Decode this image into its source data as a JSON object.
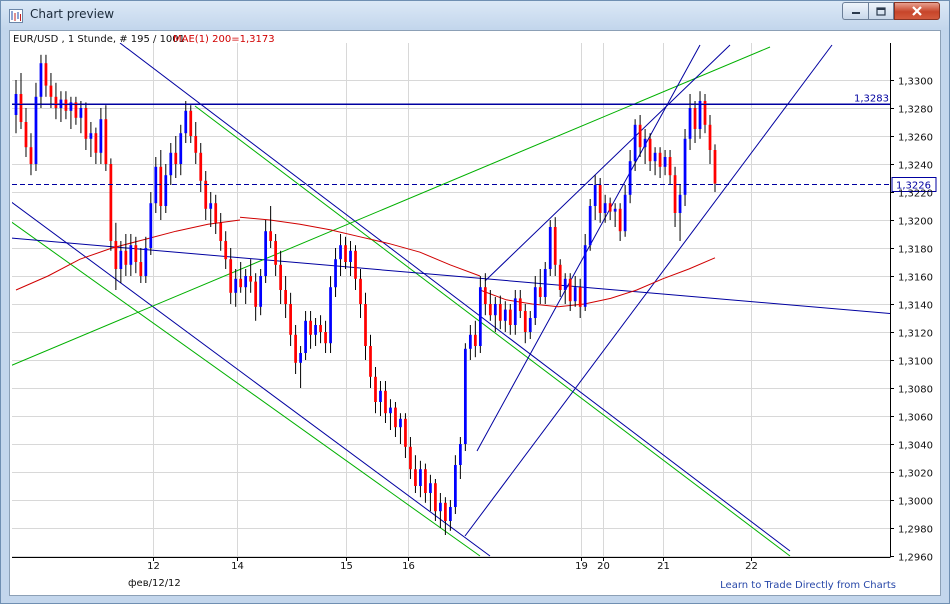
{
  "window": {
    "title": "Chart preview",
    "buttons": {
      "minimize": "minimize-icon",
      "maximize": "maximize-icon",
      "close": "close-icon"
    }
  },
  "chart_data": {
    "type": "candlestick",
    "header": "EUR/USD , 1 Stunde, # 195 / 1001",
    "indicator_label": "MAE(1) 200=1,3173",
    "ylim": [
      1.2955,
      1.3342
    ],
    "y_ticks": [
      "1,3300",
      "1,3280",
      "1,3260",
      "1,3240",
      "1,3220",
      "1,3200",
      "1,3180",
      "1,3160",
      "1,3140",
      "1,3120",
      "1,3100",
      "1,3080",
      "1,3060",
      "1,3040",
      "1,3020",
      "1,3000",
      "1,2980",
      "1,2960"
    ],
    "x_ticks": [
      "12",
      "14",
      "15",
      "16",
      "19",
      "20",
      "21",
      "22"
    ],
    "date_label": "фев/12/12",
    "level_line": {
      "value": 1.3283,
      "label": "1,3283"
    },
    "price_line": {
      "value": 1.3226,
      "label": "1,3226"
    },
    "footer_link": "Learn to Trade Directly from Charts",
    "colors": {
      "bull": "#0000ff",
      "bear": "#ff0000",
      "trend_blue": "#0000a0",
      "trend_green": "#00c000",
      "ma": "#d00000",
      "grid": "#d8d8d8"
    },
    "moving_average": [
      [
        1.315,
        1.316,
        1.3172,
        1.318,
        1.3186,
        1.3192,
        1.3197,
        1.32
      ],
      [
        1.3202,
        1.32,
        1.3197,
        1.3193,
        1.3188,
        1.3183,
        1.3177,
        1.3168,
        1.316
      ],
      [
        1.315,
        1.3143,
        1.314,
        1.3138,
        1.314,
        1.3144,
        1.315,
        1.3158,
        1.3165,
        1.3173
      ]
    ],
    "candles": [
      {
        "o": 1.3275,
        "h": 1.33,
        "l": 1.3262,
        "c": 1.329
      },
      {
        "o": 1.329,
        "h": 1.3305,
        "l": 1.3265,
        "c": 1.327
      },
      {
        "o": 1.327,
        "h": 1.328,
        "l": 1.3245,
        "c": 1.3252
      },
      {
        "o": 1.3252,
        "h": 1.3262,
        "l": 1.3232,
        "c": 1.324
      },
      {
        "o": 1.324,
        "h": 1.3298,
        "l": 1.3235,
        "c": 1.3288
      },
      {
        "o": 1.3288,
        "h": 1.3318,
        "l": 1.328,
        "c": 1.3312
      },
      {
        "o": 1.3312,
        "h": 1.3318,
        "l": 1.3288,
        "c": 1.3296
      },
      {
        "o": 1.3296,
        "h": 1.3305,
        "l": 1.328,
        "c": 1.3288
      },
      {
        "o": 1.3288,
        "h": 1.3298,
        "l": 1.3272,
        "c": 1.328
      },
      {
        "o": 1.328,
        "h": 1.3292,
        "l": 1.327,
        "c": 1.3286
      },
      {
        "o": 1.3286,
        "h": 1.3292,
        "l": 1.3272,
        "c": 1.3278
      },
      {
        "o": 1.3278,
        "h": 1.3288,
        "l": 1.3265,
        "c": 1.3284
      },
      {
        "o": 1.3284,
        "h": 1.3288,
        "l": 1.3268,
        "c": 1.3273
      },
      {
        "o": 1.3273,
        "h": 1.3285,
        "l": 1.3262,
        "c": 1.328
      },
      {
        "o": 1.328,
        "h": 1.3284,
        "l": 1.325,
        "c": 1.3258
      },
      {
        "o": 1.3258,
        "h": 1.327,
        "l": 1.3245,
        "c": 1.3262
      },
      {
        "o": 1.3262,
        "h": 1.3266,
        "l": 1.324,
        "c": 1.3248
      },
      {
        "o": 1.3248,
        "h": 1.328,
        "l": 1.324,
        "c": 1.3272
      },
      {
        "o": 1.3272,
        "h": 1.3282,
        "l": 1.3235,
        "c": 1.324
      },
      {
        "o": 1.324,
        "h": 1.3244,
        "l": 1.3178,
        "c": 1.3185
      },
      {
        "o": 1.3185,
        "h": 1.3198,
        "l": 1.315,
        "c": 1.3165
      },
      {
        "o": 1.3165,
        "h": 1.3185,
        "l": 1.3155,
        "c": 1.3178
      },
      {
        "o": 1.3178,
        "h": 1.319,
        "l": 1.316,
        "c": 1.3168
      },
      {
        "o": 1.3168,
        "h": 1.319,
        "l": 1.316,
        "c": 1.3182
      },
      {
        "o": 1.3182,
        "h": 1.3188,
        "l": 1.3162,
        "c": 1.317
      },
      {
        "o": 1.317,
        "h": 1.318,
        "l": 1.3155,
        "c": 1.316
      },
      {
        "o": 1.316,
        "h": 1.3188,
        "l": 1.3155,
        "c": 1.318
      },
      {
        "o": 1.318,
        "h": 1.322,
        "l": 1.3175,
        "c": 1.3212
      },
      {
        "o": 1.3212,
        "h": 1.3245,
        "l": 1.3205,
        "c": 1.3238
      },
      {
        "o": 1.3238,
        "h": 1.325,
        "l": 1.32,
        "c": 1.321
      },
      {
        "o": 1.321,
        "h": 1.324,
        "l": 1.3205,
        "c": 1.3232
      },
      {
        "o": 1.3232,
        "h": 1.3255,
        "l": 1.3225,
        "c": 1.3248
      },
      {
        "o": 1.3248,
        "h": 1.326,
        "l": 1.323,
        "c": 1.324
      },
      {
        "o": 1.324,
        "h": 1.3268,
        "l": 1.3232,
        "c": 1.3262
      },
      {
        "o": 1.3262,
        "h": 1.3285,
        "l": 1.3255,
        "c": 1.3278
      },
      {
        "o": 1.3278,
        "h": 1.3282,
        "l": 1.3255,
        "c": 1.326
      },
      {
        "o": 1.326,
        "h": 1.327,
        "l": 1.324,
        "c": 1.3248
      },
      {
        "o": 1.3248,
        "h": 1.3255,
        "l": 1.322,
        "c": 1.3228
      },
      {
        "o": 1.3228,
        "h": 1.3235,
        "l": 1.32,
        "c": 1.3208
      },
      {
        "o": 1.3208,
        "h": 1.322,
        "l": 1.3195,
        "c": 1.3212
      },
      {
        "o": 1.3212,
        "h": 1.3218,
        "l": 1.319,
        "c": 1.3198
      },
      {
        "o": 1.3198,
        "h": 1.3205,
        "l": 1.3178,
        "c": 1.3185
      },
      {
        "o": 1.3185,
        "h": 1.3192,
        "l": 1.3165,
        "c": 1.3172
      },
      {
        "o": 1.3172,
        "h": 1.318,
        "l": 1.314,
        "c": 1.3148
      },
      {
        "o": 1.3148,
        "h": 1.3165,
        "l": 1.3138,
        "c": 1.3158
      },
      {
        "o": 1.3158,
        "h": 1.317,
        "l": 1.3148,
        "c": 1.3152
      },
      {
        "o": 1.3152,
        "h": 1.3165,
        "l": 1.314,
        "c": 1.316
      },
      {
        "o": 1.316,
        "h": 1.3172,
        "l": 1.3148,
        "c": 1.3156
      },
      {
        "o": 1.3156,
        "h": 1.3162,
        "l": 1.3128,
        "c": 1.3138
      },
      {
        "o": 1.3138,
        "h": 1.3165,
        "l": 1.3132,
        "c": 1.316
      },
      {
        "o": 1.316,
        "h": 1.32,
        "l": 1.3155,
        "c": 1.3192
      },
      {
        "o": 1.3192,
        "h": 1.321,
        "l": 1.318,
        "c": 1.3185
      },
      {
        "o": 1.3185,
        "h": 1.319,
        "l": 1.316,
        "c": 1.3168
      },
      {
        "o": 1.3168,
        "h": 1.3178,
        "l": 1.314,
        "c": 1.315
      },
      {
        "o": 1.315,
        "h": 1.316,
        "l": 1.313,
        "c": 1.314
      },
      {
        "o": 1.314,
        "h": 1.3148,
        "l": 1.311,
        "c": 1.3118
      },
      {
        "o": 1.3118,
        "h": 1.3125,
        "l": 1.309,
        "c": 1.3098
      },
      {
        "o": 1.3098,
        "h": 1.311,
        "l": 1.308,
        "c": 1.3105
      },
      {
        "o": 1.3105,
        "h": 1.3135,
        "l": 1.31,
        "c": 1.3128
      },
      {
        "o": 1.3128,
        "h": 1.3135,
        "l": 1.3108,
        "c": 1.3118
      },
      {
        "o": 1.3118,
        "h": 1.313,
        "l": 1.311,
        "c": 1.3125
      },
      {
        "o": 1.3125,
        "h": 1.3132,
        "l": 1.3112,
        "c": 1.312
      },
      {
        "o": 1.312,
        "h": 1.3128,
        "l": 1.3105,
        "c": 1.3112
      },
      {
        "o": 1.3112,
        "h": 1.316,
        "l": 1.3105,
        "c": 1.3152
      },
      {
        "o": 1.3152,
        "h": 1.318,
        "l": 1.3145,
        "c": 1.3172
      },
      {
        "o": 1.3172,
        "h": 1.319,
        "l": 1.316,
        "c": 1.3182
      },
      {
        "o": 1.3182,
        "h": 1.3188,
        "l": 1.3165,
        "c": 1.317
      },
      {
        "o": 1.317,
        "h": 1.3185,
        "l": 1.316,
        "c": 1.3178
      },
      {
        "o": 1.3178,
        "h": 1.3182,
        "l": 1.315,
        "c": 1.3158
      },
      {
        "o": 1.3158,
        "h": 1.3165,
        "l": 1.313,
        "c": 1.314
      },
      {
        "o": 1.314,
        "h": 1.3148,
        "l": 1.31,
        "c": 1.311
      },
      {
        "o": 1.311,
        "h": 1.3118,
        "l": 1.308,
        "c": 1.3088
      },
      {
        "o": 1.3088,
        "h": 1.3095,
        "l": 1.3062,
        "c": 1.307
      },
      {
        "o": 1.307,
        "h": 1.3085,
        "l": 1.306,
        "c": 1.3078
      },
      {
        "o": 1.3078,
        "h": 1.3085,
        "l": 1.3055,
        "c": 1.3062
      },
      {
        "o": 1.3062,
        "h": 1.3072,
        "l": 1.305,
        "c": 1.3066
      },
      {
        "o": 1.3066,
        "h": 1.307,
        "l": 1.3045,
        "c": 1.3052
      },
      {
        "o": 1.3052,
        "h": 1.3062,
        "l": 1.304,
        "c": 1.3058
      },
      {
        "o": 1.3058,
        "h": 1.3062,
        "l": 1.303,
        "c": 1.3038
      },
      {
        "o": 1.3038,
        "h": 1.3045,
        "l": 1.3015,
        "c": 1.3022
      },
      {
        "o": 1.3022,
        "h": 1.3032,
        "l": 1.3005,
        "c": 1.301
      },
      {
        "o": 1.301,
        "h": 1.3028,
        "l": 1.3002,
        "c": 1.3022
      },
      {
        "o": 1.3022,
        "h": 1.3026,
        "l": 1.2998,
        "c": 1.3005
      },
      {
        "o": 1.3005,
        "h": 1.3018,
        "l": 1.2992,
        "c": 1.3012
      },
      {
        "o": 1.3012,
        "h": 1.3015,
        "l": 1.2985,
        "c": 1.2992
      },
      {
        "o": 1.2992,
        "h": 1.3005,
        "l": 1.298,
        "c": 1.2998
      },
      {
        "o": 1.2998,
        "h": 1.3002,
        "l": 1.2975,
        "c": 1.2985
      },
      {
        "o": 1.2985,
        "h": 1.3,
        "l": 1.2978,
        "c": 1.2995
      },
      {
        "o": 1.2995,
        "h": 1.3032,
        "l": 1.299,
        "c": 1.3025
      },
      {
        "o": 1.3025,
        "h": 1.3045,
        "l": 1.3015,
        "c": 1.304
      },
      {
        "o": 1.304,
        "h": 1.3112,
        "l": 1.3035,
        "c": 1.3108
      },
      {
        "o": 1.3108,
        "h": 1.3125,
        "l": 1.31,
        "c": 1.3118
      },
      {
        "o": 1.3118,
        "h": 1.3128,
        "l": 1.3102,
        "c": 1.311
      },
      {
        "o": 1.311,
        "h": 1.316,
        "l": 1.3105,
        "c": 1.3152
      },
      {
        "o": 1.3152,
        "h": 1.3162,
        "l": 1.3132,
        "c": 1.314
      },
      {
        "o": 1.314,
        "h": 1.315,
        "l": 1.3128,
        "c": 1.3132
      },
      {
        "o": 1.3132,
        "h": 1.3145,
        "l": 1.312,
        "c": 1.314
      },
      {
        "o": 1.314,
        "h": 1.3146,
        "l": 1.3122,
        "c": 1.3128
      },
      {
        "o": 1.3128,
        "h": 1.3142,
        "l": 1.312,
        "c": 1.3136
      },
      {
        "o": 1.3136,
        "h": 1.314,
        "l": 1.3118,
        "c": 1.3125
      },
      {
        "o": 1.3125,
        "h": 1.315,
        "l": 1.3118,
        "c": 1.3144
      },
      {
        "o": 1.3144,
        "h": 1.315,
        "l": 1.313,
        "c": 1.3135
      },
      {
        "o": 1.3135,
        "h": 1.314,
        "l": 1.3112,
        "c": 1.312
      },
      {
        "o": 1.312,
        "h": 1.3135,
        "l": 1.3115,
        "c": 1.313
      },
      {
        "o": 1.313,
        "h": 1.316,
        "l": 1.3125,
        "c": 1.3152
      },
      {
        "o": 1.3152,
        "h": 1.3165,
        "l": 1.314,
        "c": 1.3145
      },
      {
        "o": 1.3145,
        "h": 1.317,
        "l": 1.314,
        "c": 1.3165
      },
      {
        "o": 1.3165,
        "h": 1.32,
        "l": 1.316,
        "c": 1.3195
      },
      {
        "o": 1.3195,
        "h": 1.3202,
        "l": 1.316,
        "c": 1.3168
      },
      {
        "o": 1.3168,
        "h": 1.3172,
        "l": 1.3145,
        "c": 1.315
      },
      {
        "o": 1.315,
        "h": 1.3162,
        "l": 1.314,
        "c": 1.3158
      },
      {
        "o": 1.3158,
        "h": 1.3162,
        "l": 1.3135,
        "c": 1.3142
      },
      {
        "o": 1.3142,
        "h": 1.316,
        "l": 1.3138,
        "c": 1.3152
      },
      {
        "o": 1.3152,
        "h": 1.3158,
        "l": 1.313,
        "c": 1.3138
      },
      {
        "o": 1.3138,
        "h": 1.319,
        "l": 1.3135,
        "c": 1.3182
      },
      {
        "o": 1.3182,
        "h": 1.3215,
        "l": 1.3178,
        "c": 1.321
      },
      {
        "o": 1.321,
        "h": 1.3232,
        "l": 1.32,
        "c": 1.3225
      },
      {
        "o": 1.3225,
        "h": 1.323,
        "l": 1.3198,
        "c": 1.3205
      },
      {
        "o": 1.3205,
        "h": 1.3218,
        "l": 1.3198,
        "c": 1.3212
      },
      {
        "o": 1.3212,
        "h": 1.3216,
        "l": 1.32,
        "c": 1.3206
      },
      {
        "o": 1.3206,
        "h": 1.3212,
        "l": 1.3195,
        "c": 1.3208
      },
      {
        "o": 1.3208,
        "h": 1.3212,
        "l": 1.3185,
        "c": 1.3192
      },
      {
        "o": 1.3192,
        "h": 1.3225,
        "l": 1.3188,
        "c": 1.3218
      },
      {
        "o": 1.3218,
        "h": 1.325,
        "l": 1.3212,
        "c": 1.3242
      },
      {
        "o": 1.3242,
        "h": 1.3272,
        "l": 1.3235,
        "c": 1.3268
      },
      {
        "o": 1.3268,
        "h": 1.3275,
        "l": 1.3245,
        "c": 1.3252
      },
      {
        "o": 1.3252,
        "h": 1.3265,
        "l": 1.324,
        "c": 1.3258
      },
      {
        "o": 1.3258,
        "h": 1.3262,
        "l": 1.3235,
        "c": 1.3242
      },
      {
        "o": 1.3242,
        "h": 1.3252,
        "l": 1.3232,
        "c": 1.3248
      },
      {
        "o": 1.3248,
        "h": 1.3252,
        "l": 1.323,
        "c": 1.3238
      },
      {
        "o": 1.3238,
        "h": 1.325,
        "l": 1.3232,
        "c": 1.3245
      },
      {
        "o": 1.3245,
        "h": 1.325,
        "l": 1.3225,
        "c": 1.3232
      },
      {
        "o": 1.3232,
        "h": 1.3238,
        "l": 1.3195,
        "c": 1.3205
      },
      {
        "o": 1.3205,
        "h": 1.3225,
        "l": 1.3185,
        "c": 1.3218
      },
      {
        "o": 1.3218,
        "h": 1.3265,
        "l": 1.321,
        "c": 1.3258
      },
      {
        "o": 1.3258,
        "h": 1.329,
        "l": 1.325,
        "c": 1.328
      },
      {
        "o": 1.328,
        "h": 1.3285,
        "l": 1.3255,
        "c": 1.3265
      },
      {
        "o": 1.3265,
        "h": 1.3292,
        "l": 1.3258,
        "c": 1.3285
      },
      {
        "o": 1.3285,
        "h": 1.329,
        "l": 1.3262,
        "c": 1.3268
      },
      {
        "o": 1.3268,
        "h": 1.3275,
        "l": 1.324,
        "c": 1.325
      },
      {
        "o": 1.325,
        "h": 1.3254,
        "l": 1.322,
        "c": 1.3226
      }
    ]
  }
}
